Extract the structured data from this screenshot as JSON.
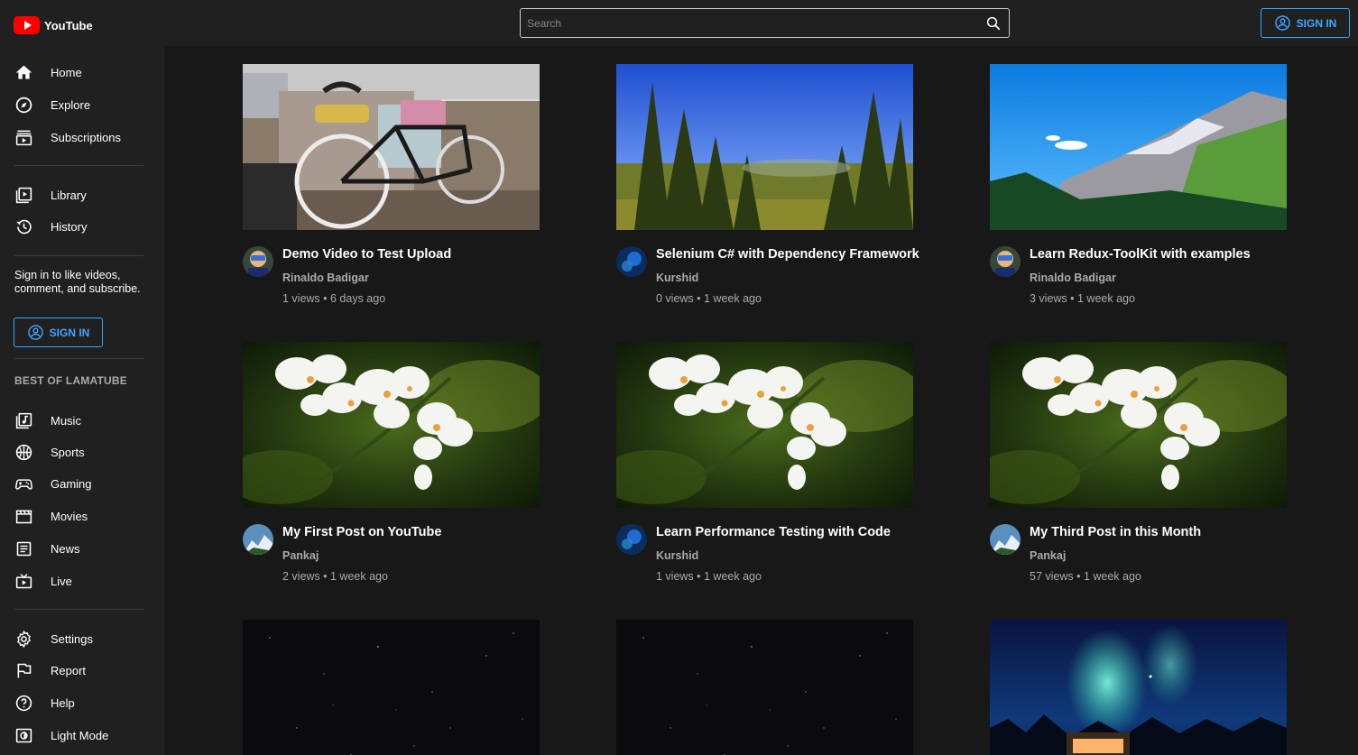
{
  "app": {
    "logo_text": "YouTube"
  },
  "search": {
    "placeholder": "Search"
  },
  "header": {
    "signin_label": "SIGN IN"
  },
  "sidebar": {
    "primary": [
      {
        "label": "Home",
        "icon": "home-icon"
      },
      {
        "label": "Explore",
        "icon": "explore-icon"
      },
      {
        "label": "Subscriptions",
        "icon": "subscriptions-icon"
      }
    ],
    "library": [
      {
        "label": "Library",
        "icon": "library-icon"
      },
      {
        "label": "History",
        "icon": "history-icon"
      }
    ],
    "signin_note": "Sign in to like videos, comment, and subscribe.",
    "signin_label": "SIGN IN",
    "section_title": "BEST OF LAMATUBE",
    "best_of": [
      {
        "label": "Music",
        "icon": "music-icon"
      },
      {
        "label": "Sports",
        "icon": "sports-icon"
      },
      {
        "label": "Gaming",
        "icon": "gaming-icon"
      },
      {
        "label": "Movies",
        "icon": "movies-icon"
      },
      {
        "label": "News",
        "icon": "news-icon"
      },
      {
        "label": "Live",
        "icon": "live-icon"
      }
    ],
    "footer": [
      {
        "label": "Settings",
        "icon": "settings-icon"
      },
      {
        "label": "Report",
        "icon": "flag-icon"
      },
      {
        "label": "Help",
        "icon": "help-icon"
      },
      {
        "label": "Light Mode",
        "icon": "light-mode-icon"
      }
    ]
  },
  "videos": [
    {
      "title": "Demo Video to Test Upload",
      "channel": "Rinaldo Badigar",
      "stats": "1 views • 6 days ago",
      "thumbnail": "bicycle-thumbnail",
      "avatar": "cartoon-avatar"
    },
    {
      "title": "Selenium C# with Dependency Framework",
      "channel": "Kurshid",
      "stats": "0 views • 1 week ago",
      "thumbnail": "forest-thumbnail",
      "avatar": "blue-avatar"
    },
    {
      "title": "Learn Redux-ToolKit with examples",
      "channel": "Rinaldo Badigar",
      "stats": "3 views • 1 week ago",
      "thumbnail": "mountain-thumbnail",
      "avatar": "cartoon-avatar"
    },
    {
      "title": "My First Post on YouTube",
      "channel": "Pankaj",
      "stats": "2 views • 1 week ago",
      "thumbnail": "orchid-thumbnail",
      "avatar": "mountain-avatar"
    },
    {
      "title": "Learn Performance Testing with Code",
      "channel": "Kurshid",
      "stats": "1 views • 1 week ago",
      "thumbnail": "orchid-thumbnail",
      "avatar": "blue-avatar"
    },
    {
      "title": "My Third Post in this Month",
      "channel": "Pankaj",
      "stats": "57 views • 1 week ago",
      "thumbnail": "orchid-thumbnail",
      "avatar": "mountain-avatar"
    },
    {
      "title": "",
      "channel": "",
      "stats": "",
      "thumbnail": "starry-sky-thumbnail",
      "avatar": ""
    },
    {
      "title": "",
      "channel": "",
      "stats": "",
      "thumbnail": "starry-sky-thumbnail",
      "avatar": ""
    },
    {
      "title": "",
      "channel": "",
      "stats": "",
      "thumbnail": "aurora-thumbnail",
      "avatar": ""
    }
  ],
  "colors": {
    "background": "#181818",
    "sidebar": "#202020",
    "accent": "#3ea6ff",
    "logo_red": "#ff0000",
    "muted_text": "#aaaaaa"
  }
}
